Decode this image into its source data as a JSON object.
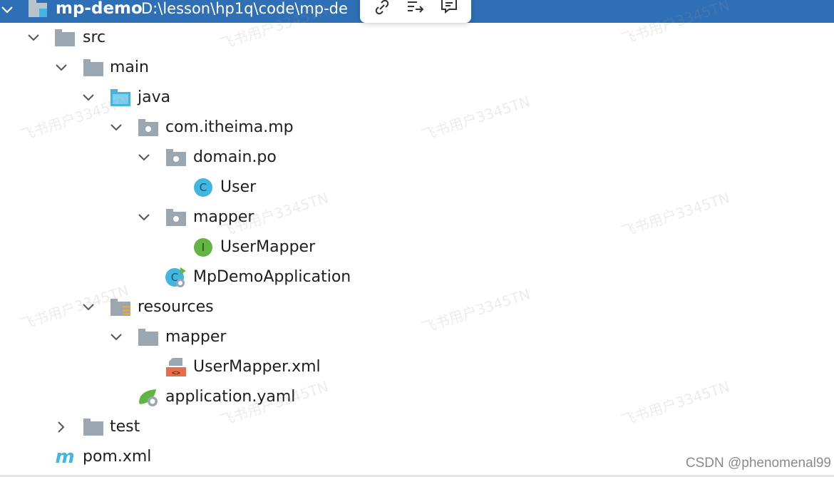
{
  "project": {
    "name": "mp-demo",
    "path": "D:\\lesson\\hp1q\\code\\mp-de"
  },
  "toolbar": {
    "buttons": [
      {
        "name": "link-icon"
      },
      {
        "name": "share-icon"
      },
      {
        "name": "comment-icon"
      }
    ]
  },
  "tree": {
    "items": [
      {
        "label": "src"
      },
      {
        "label": "main"
      },
      {
        "label": "java"
      },
      {
        "label": "com.itheima.mp"
      },
      {
        "label": "domain.po"
      },
      {
        "label": "User"
      },
      {
        "label": "mapper"
      },
      {
        "label": "UserMapper"
      },
      {
        "label": "MpDemoApplication"
      },
      {
        "label": "resources"
      },
      {
        "label": "mapper"
      },
      {
        "label": "UserMapper.xml"
      },
      {
        "label": "application.yaml"
      },
      {
        "label": "test"
      },
      {
        "label": "pom.xml"
      }
    ]
  },
  "watermark": {
    "text": "飞书用户3345TN"
  },
  "credit": "CSDN @phenomenal99",
  "colors": {
    "header_bg": "#2f6fb5",
    "folder_gray": "#9aa7b0",
    "java_folder": "#40b6e0",
    "class_icon": "#40b6e0",
    "interface_icon": "#62b543",
    "xml_icon": "#e4704a",
    "spring_icon": "#62b543"
  }
}
